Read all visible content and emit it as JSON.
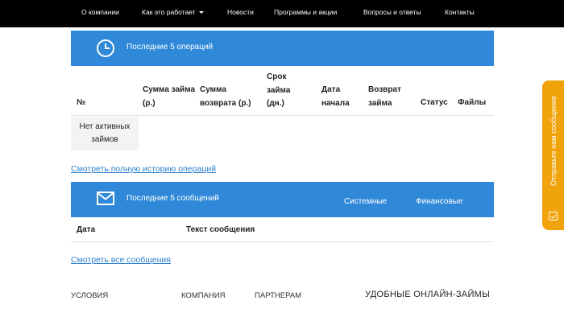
{
  "nav": {
    "items": [
      {
        "label": "О компании"
      },
      {
        "label": "Как это работает"
      },
      {
        "label": "Новости"
      },
      {
        "label": "Программы и акции"
      },
      {
        "label": "Вопросы и ответы"
      },
      {
        "label": "Контакты"
      }
    ]
  },
  "operations": {
    "title": "Последние 5 операций",
    "columns": [
      "№",
      "Сумма займа (р.)",
      "Сумма возврата (р.)",
      "Срок займа (дн.)",
      "Дата начала",
      "Возврат займа",
      "Статус",
      "Файлы"
    ],
    "empty_text": "Нет активных займов",
    "history_link": "Смотреть полную историю операций"
  },
  "messages": {
    "title": "Последние 5 сообщений",
    "tabs": [
      "Системные",
      "Финансовые"
    ],
    "columns": [
      "Дата",
      "Текст сообщения"
    ],
    "all_link": "Смотреть все сообщения"
  },
  "footer": {
    "columns": [
      "Условия",
      "Компания",
      "Партнерам"
    ],
    "brand": "УДОБНЫЕ ОНЛАЙН-ЗАЙМЫ"
  },
  "feedback": {
    "label": "Отправьте нам сообщение"
  },
  "colors": {
    "accent": "#2f88d8",
    "nav_bg": "#000000",
    "link": "#2b7fcf",
    "feedback": "#f0a30a"
  }
}
